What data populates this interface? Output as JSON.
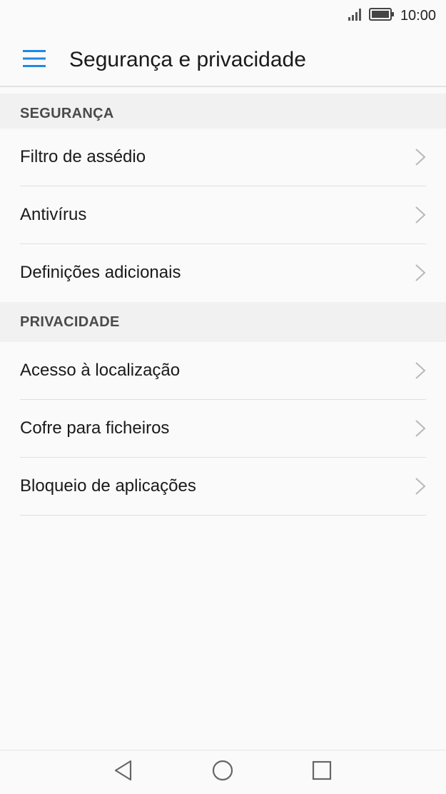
{
  "status_bar": {
    "time": "10:00",
    "signal_icon": "signal-bars-icon",
    "battery_icon": "battery-full-icon"
  },
  "app_bar": {
    "title": "Segurança e privacidade",
    "menu_icon": "hamburger-menu-icon",
    "accent_color": "#1e88e5"
  },
  "sections": [
    {
      "header": "SEGURANÇA",
      "items": [
        {
          "label": "Filtro de assédio"
        },
        {
          "label": "Antivírus"
        },
        {
          "label": "Definições adicionais"
        }
      ]
    },
    {
      "header": "PRIVACIDADE",
      "items": [
        {
          "label": "Acesso à localização"
        },
        {
          "label": "Cofre para ficheiros"
        },
        {
          "label": "Bloqueio de aplicações"
        }
      ]
    }
  ],
  "nav_bar": {
    "back_icon": "back-triangle-icon",
    "home_icon": "home-circle-icon",
    "recents_icon": "recents-square-icon"
  }
}
